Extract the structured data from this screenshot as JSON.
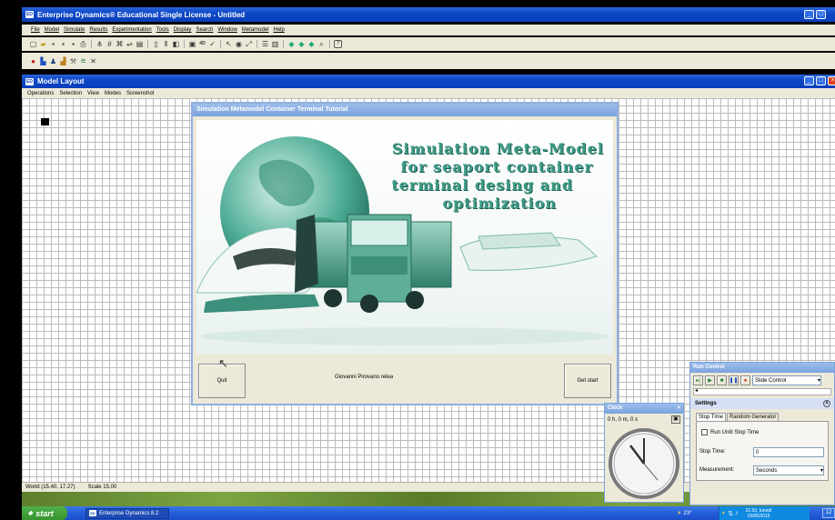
{
  "app": {
    "title": "Enterprise Dynamics® Educational Single License - Untitled",
    "menu": [
      "File",
      "Model",
      "Simulate",
      "Results",
      "Experimentation",
      "Tools",
      "Display",
      "Search",
      "Window",
      "Metamodel",
      "Help"
    ]
  },
  "model_layout": {
    "title": "Model Layout",
    "menu": [
      "Operations",
      "Selection",
      "View",
      "Modes",
      "Screenshot"
    ],
    "status_coords": "World (15.40, 17.27)",
    "status_scale": "Scale 15.00"
  },
  "tutorial": {
    "title": "Simulation Metamodel Container Terminal Tutorial",
    "banner_lines": [
      "Simulation Meta-Model",
      "for seaport container",
      "terminal desing and",
      "optimization"
    ],
    "author": "Giovanni Pirovano relea",
    "quit_label": "Quit",
    "start_label": "Get start"
  },
  "clock": {
    "title": "Clock",
    "time": "0 h, 0 m, 0 s"
  },
  "run_control": {
    "title": "Run Control",
    "mode": "Slide Control",
    "settings_title": "Settings",
    "tabs": [
      "Stop Time",
      "Random Generator"
    ],
    "run_until_label": "Run Until Stop Time",
    "run_until_checked": false,
    "stop_time_label": "Stop Time:",
    "stop_time_value": "0",
    "measurement_label": "Measurement:",
    "measurement_value": "Seconds"
  },
  "taskbar": {
    "start_label": "start",
    "task_label": "Enterprise Dynamics 8.2",
    "clock_time": "22.50, lunedì",
    "clock_date": "15/06/2015",
    "tray_text": "23°",
    "edge_text": "12"
  },
  "colors": {
    "xp_blue": "#0a3fb8",
    "banner_green": "#3d9a86",
    "desktop_green": "#6b8f3a"
  }
}
